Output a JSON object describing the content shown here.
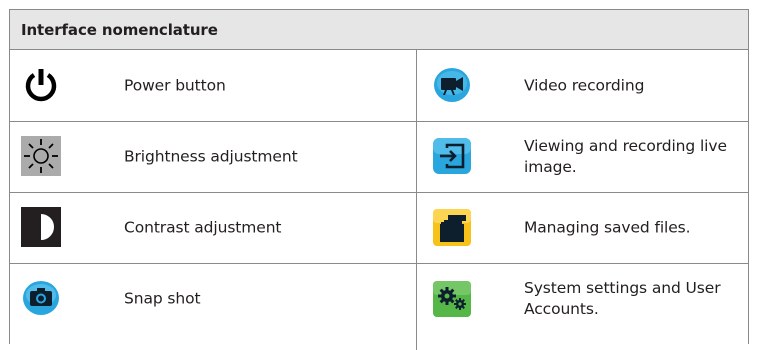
{
  "table": {
    "title": "Interface nomenclature",
    "rows": [
      {
        "left": {
          "icon": "power-icon",
          "label": "Power button"
        },
        "right": {
          "icon": "video-camera-icon",
          "label": "Video recording"
        }
      },
      {
        "left": {
          "icon": "brightness-icon",
          "label": "Brightness adjustment"
        },
        "right": {
          "icon": "live-image-icon",
          "label": "Viewing and recording live image."
        }
      },
      {
        "left": {
          "icon": "contrast-icon",
          "label": "Contrast adjustment"
        },
        "right": {
          "icon": "folders-icon",
          "label": "Managing saved files."
        }
      },
      {
        "left": {
          "icon": "camera-icon",
          "label": "Snap shot"
        },
        "right": {
          "icon": "gears-icon",
          "label": "System settings and User Accounts."
        }
      }
    ]
  },
  "colors": {
    "header_bg": "#e6e6e6",
    "border": "#8a8a8a",
    "blue_icon": "#2aa6df",
    "yellow_icon": "#f7c21a",
    "green_icon": "#55b748",
    "dark_icon": "#231f20"
  }
}
